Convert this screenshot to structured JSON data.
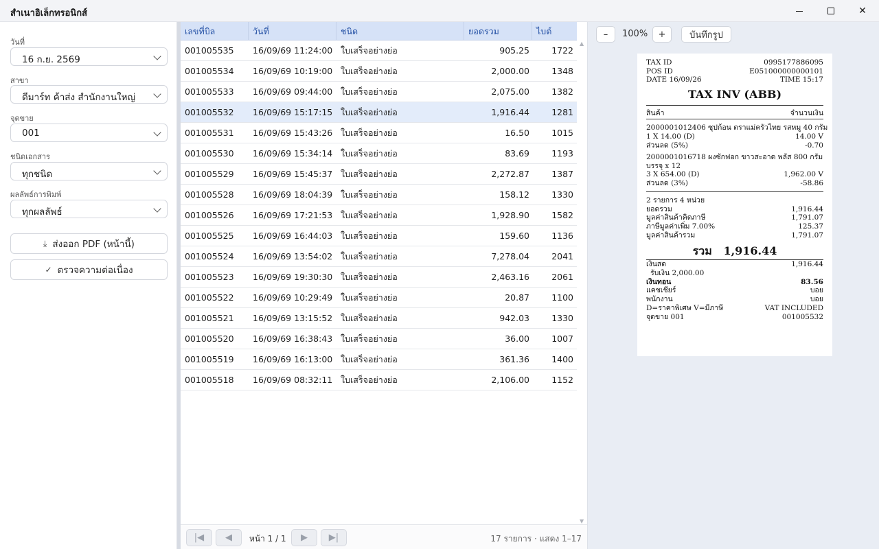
{
  "window": {
    "title": "สำเนาอิเล็กทรอนิกส์",
    "minimize_icon": "minimize-icon",
    "maximize_icon": "maximize-icon",
    "close_icon": "close-icon"
  },
  "filters": {
    "date": {
      "label": "วันที่",
      "value": "16 ก.ย. 2569"
    },
    "branch": {
      "label": "สาขา",
      "value": "ดีมาร์ท ค้าส่ง สำนักงานใหญ่"
    },
    "pos": {
      "label": "จุดขาย",
      "value": "001"
    },
    "doc_type": {
      "label": "ชนิดเอกสาร",
      "value": "ทุกชนิด"
    },
    "print_result": {
      "label": "ผลลัพธ์การพิมพ์",
      "value": "ทุกผลลัพธ์"
    }
  },
  "actions": {
    "export_pdf": "ส่งออก PDF (หน้านี้)",
    "check_continuity": "ตรวจความต่อเนื่อง"
  },
  "table": {
    "columns": [
      "เลขที่บิล",
      "วันที่",
      "ชนิด",
      "ยอดรวม",
      "ไบต์"
    ],
    "rows": [
      {
        "bill": "001005535",
        "date": "16/09/69 11:24:00",
        "type": "ใบเสร็จอย่างย่อ",
        "total": "905.25",
        "bytes": "1722"
      },
      {
        "bill": "001005534",
        "date": "16/09/69 10:19:00",
        "type": "ใบเสร็จอย่างย่อ",
        "total": "2,000.00",
        "bytes": "1348"
      },
      {
        "bill": "001005533",
        "date": "16/09/69 09:44:00",
        "type": "ใบเสร็จอย่างย่อ",
        "total": "2,075.00",
        "bytes": "1382"
      },
      {
        "bill": "001005532",
        "date": "16/09/69 15:17:15",
        "type": "ใบเสร็จอย่างย่อ",
        "total": "1,916.44",
        "bytes": "1281"
      },
      {
        "bill": "001005531",
        "date": "16/09/69 15:43:26",
        "type": "ใบเสร็จอย่างย่อ",
        "total": "16.50",
        "bytes": "1015"
      },
      {
        "bill": "001005530",
        "date": "16/09/69 15:34:14",
        "type": "ใบเสร็จอย่างย่อ",
        "total": "83.69",
        "bytes": "1193"
      },
      {
        "bill": "001005529",
        "date": "16/09/69 15:45:37",
        "type": "ใบเสร็จอย่างย่อ",
        "total": "2,272.87",
        "bytes": "1387"
      },
      {
        "bill": "001005528",
        "date": "16/09/69 18:04:39",
        "type": "ใบเสร็จอย่างย่อ",
        "total": "158.12",
        "bytes": "1330"
      },
      {
        "bill": "001005526",
        "date": "16/09/69 17:21:53",
        "type": "ใบเสร็จอย่างย่อ",
        "total": "1,928.90",
        "bytes": "1582"
      },
      {
        "bill": "001005525",
        "date": "16/09/69 16:44:03",
        "type": "ใบเสร็จอย่างย่อ",
        "total": "159.60",
        "bytes": "1136"
      },
      {
        "bill": "001005524",
        "date": "16/09/69 13:54:02",
        "type": "ใบเสร็จอย่างย่อ",
        "total": "7,278.04",
        "bytes": "2041"
      },
      {
        "bill": "001005523",
        "date": "16/09/69 19:30:30",
        "type": "ใบเสร็จอย่างย่อ",
        "total": "2,463.16",
        "bytes": "2061"
      },
      {
        "bill": "001005522",
        "date": "16/09/69 10:29:49",
        "type": "ใบเสร็จอย่างย่อ",
        "total": "20.87",
        "bytes": "1100"
      },
      {
        "bill": "001005521",
        "date": "16/09/69 13:15:52",
        "type": "ใบเสร็จอย่างย่อ",
        "total": "942.03",
        "bytes": "1330"
      },
      {
        "bill": "001005520",
        "date": "16/09/69 16:38:43",
        "type": "ใบเสร็จอย่างย่อ",
        "total": "36.00",
        "bytes": "1007"
      },
      {
        "bill": "001005519",
        "date": "16/09/69 16:13:00",
        "type": "ใบเสร็จอย่างย่อ",
        "total": "361.36",
        "bytes": "1400"
      },
      {
        "bill": "001005518",
        "date": "16/09/69 08:32:11",
        "type": "ใบเสร็จอย่างย่อ",
        "total": "2,106.00",
        "bytes": "1152"
      }
    ],
    "selected_row_index": 3
  },
  "pager": {
    "first": "|◀",
    "prev": "◀",
    "next": "▶",
    "last": "▶|",
    "page_label": "หน้า 1 / 1",
    "count_label": "17 รายการ · แสดง 1–17"
  },
  "preview": {
    "zoom_out": "–",
    "zoom_level": "100%",
    "zoom_in": "+",
    "save_image": "บันทึกรูป"
  },
  "receipt": {
    "tax_id_label": "TAX ID",
    "tax_id": "0995177886095",
    "pos_id_label": "POS ID",
    "pos_id": "E051000000000101",
    "date": "DATE 16/09/26",
    "time": "TIME 15:17",
    "doc_title": "TAX INV (ABB)",
    "col_item": "สินค้า",
    "col_amount": "จำนวนเงิน",
    "item1_line1": "2000001012406 ซุปก้อน ตราแม่ครัวไทย รสหมู 40 กรัม",
    "item1_qty": "1 X 14.00 (D)",
    "item1_amt": "14.00 V",
    "item1_disc_label": "ส่วนลด (5%)",
    "item1_disc": "-0.70",
    "item2_line1": "2000001016718 ผงซักฟอก ขาวสะอาด พลัส 800 กรัม",
    "item2_line2": "บรรจุ x 12",
    "item2_qty": "3 X 654.00 (D)",
    "item2_amt": "1,962.00 V",
    "item2_disc_label": "ส่วนลด (3%)",
    "item2_disc": "-58.86",
    "summary_count": "2 รายการ   4 หน่วย",
    "gross_label": "ยอดรวม",
    "gross": "1,916.44",
    "taxable_label": "มูลค่าสินค้าคิดภาษี",
    "taxable": "1,791.07",
    "vat_label": "ภาษีมูลค่าเพิ่ม 7.00%",
    "vat": "125.37",
    "net_label": "มูลค่าสินค้ารวม",
    "net": "1,791.07",
    "total_label": "รวม",
    "total": "1,916.44",
    "cash_label": "เงินสด",
    "cash": "1,916.44",
    "received": "รับเงิน 2,000.00",
    "change_label": "เงินทอน",
    "change": "83.56",
    "cashier_label": "แคชเชียร์",
    "cashier": "บอย",
    "staff_label": "พนักงาน",
    "staff": "บอย",
    "legend": "D=ราคาพิเศษ  V=มีภาษี",
    "vat_included": "VAT INCLUDED",
    "pos_label": "จุดขาย  001",
    "bill_no": "001005532"
  }
}
